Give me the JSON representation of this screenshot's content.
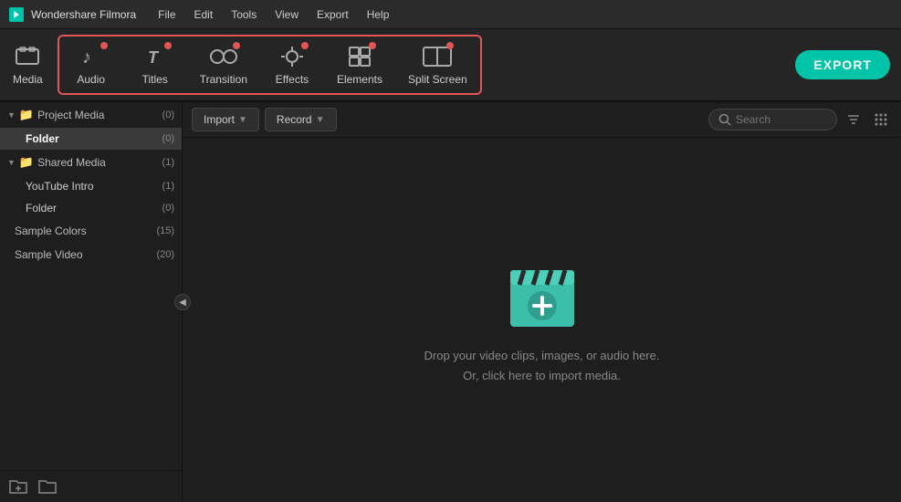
{
  "app": {
    "name": "Wondershare Filmora",
    "logo_color": "#00c4a7"
  },
  "menus": [
    "File",
    "Edit",
    "Tools",
    "View",
    "Export",
    "Help"
  ],
  "toolbar": {
    "items": [
      {
        "id": "media",
        "label": "Media",
        "active": false,
        "has_dot": false
      },
      {
        "id": "audio",
        "label": "Audio",
        "active": true,
        "has_dot": true
      },
      {
        "id": "titles",
        "label": "Titles",
        "active": true,
        "has_dot": true
      },
      {
        "id": "transition",
        "label": "Transition",
        "active": true,
        "has_dot": true
      },
      {
        "id": "effects",
        "label": "Effects",
        "active": true,
        "has_dot": true
      },
      {
        "id": "elements",
        "label": "Elements",
        "active": true,
        "has_dot": true
      },
      {
        "id": "split-screen",
        "label": "Split Screen",
        "active": true,
        "has_dot": true
      }
    ],
    "export_label": "EXPORT"
  },
  "content_toolbar": {
    "import_label": "Import",
    "record_label": "Record",
    "search_placeholder": "Search"
  },
  "sidebar": {
    "sections": [
      {
        "id": "project-media",
        "label": "Project Media",
        "count": "(0)",
        "expanded": true,
        "children": [
          {
            "id": "folder",
            "label": "Folder",
            "count": "(0)",
            "active": true
          }
        ]
      },
      {
        "id": "shared-media",
        "label": "Shared Media",
        "count": "(1)",
        "expanded": true,
        "children": [
          {
            "id": "youtube-intro",
            "label": "YouTube Intro",
            "count": "(1)",
            "active": false
          },
          {
            "id": "folder2",
            "label": "Folder",
            "count": "(0)",
            "active": false
          }
        ]
      },
      {
        "id": "sample-colors",
        "label": "Sample Colors",
        "count": "(15)",
        "expanded": false,
        "children": []
      },
      {
        "id": "sample-video",
        "label": "Sample Video",
        "count": "(20)",
        "expanded": false,
        "children": []
      }
    ],
    "bottom_icons": [
      "new-folder-icon",
      "folder-icon"
    ]
  },
  "drop_area": {
    "line1": "Drop your video clips, images, or audio here.",
    "line2": "Or, click here to import media."
  }
}
